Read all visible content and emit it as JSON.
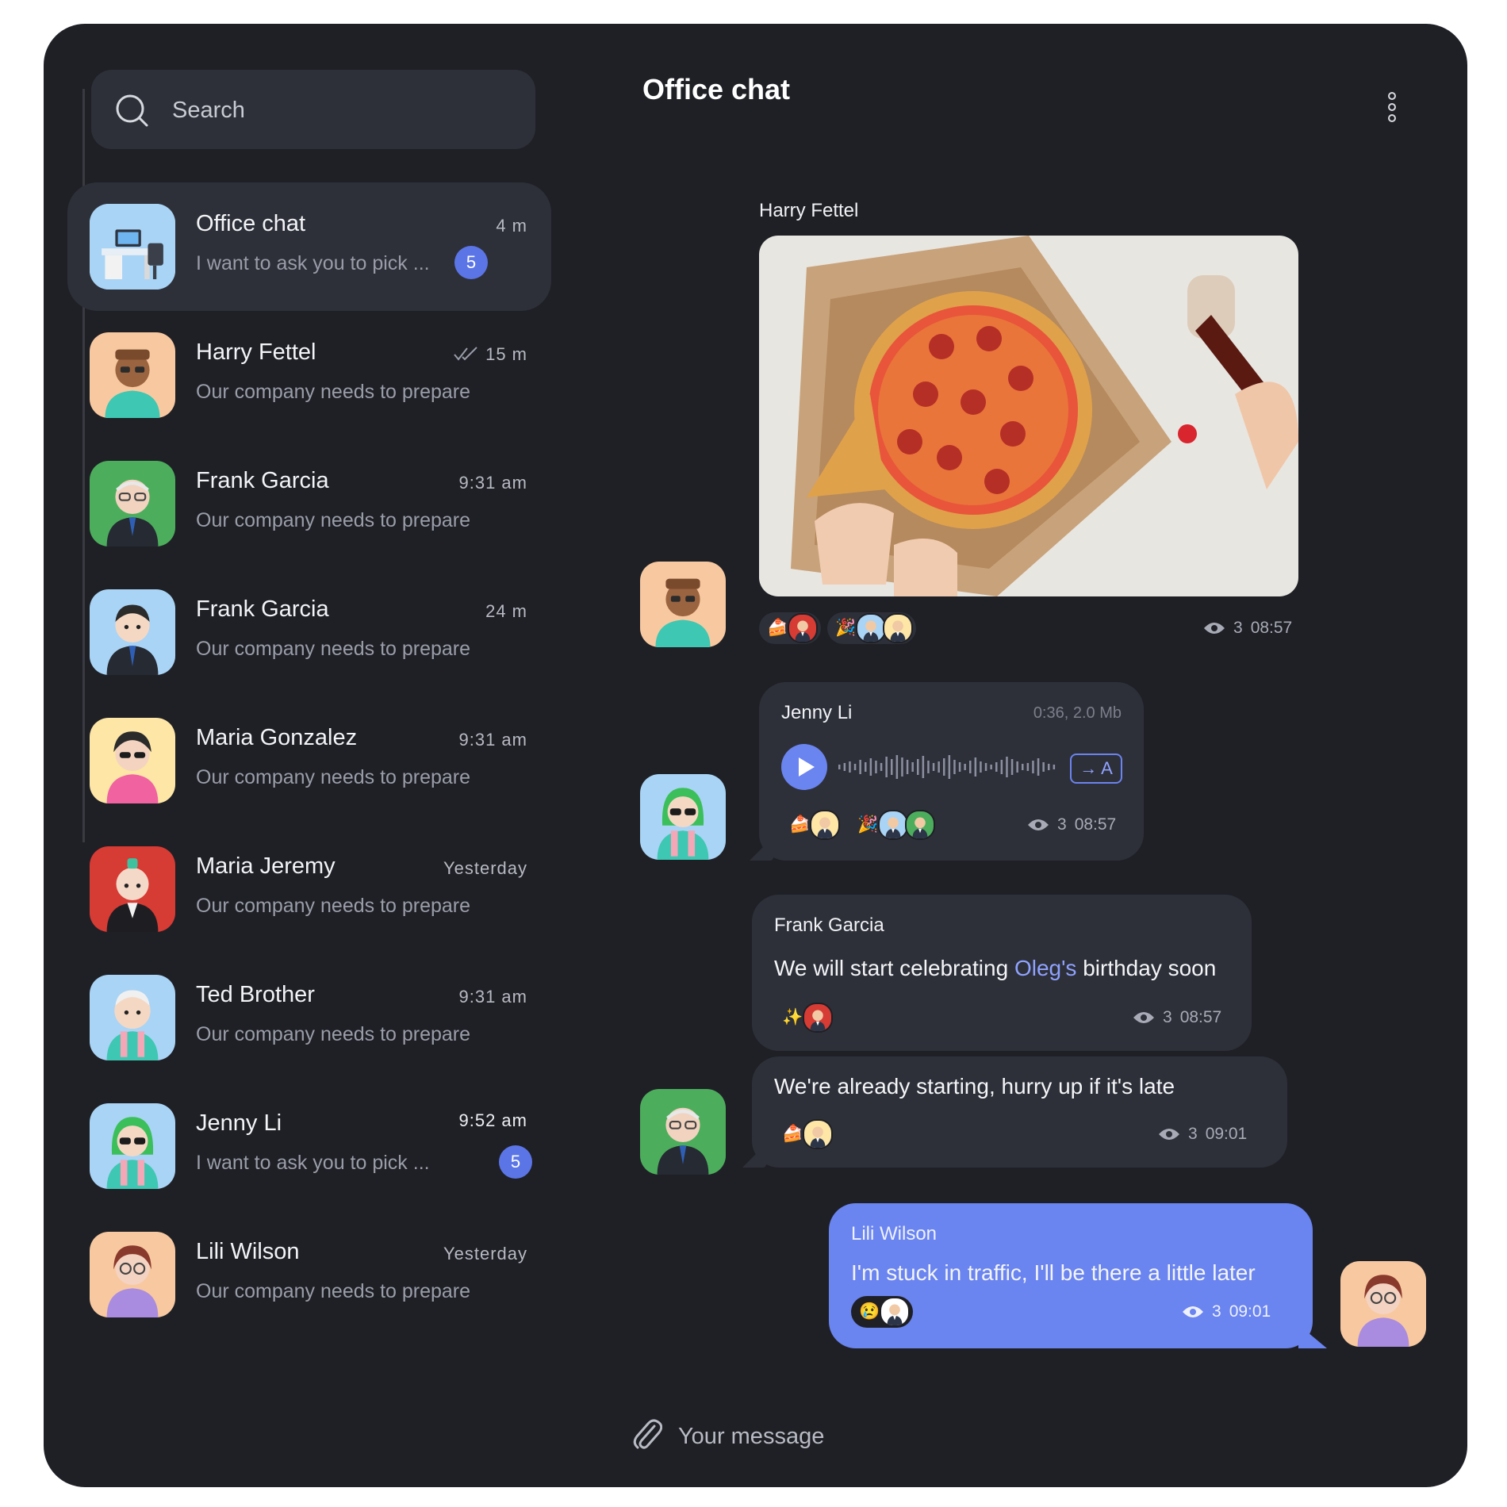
{
  "search": {
    "placeholder": "Search",
    "icon": "search-icon"
  },
  "sidebar": {
    "chats": [
      {
        "name": "Office chat",
        "preview": "I want to ask you to pick ...",
        "time": "4 m",
        "unread": "5",
        "avatar": "desk-avatar"
      },
      {
        "name": "Harry Fettel",
        "preview": "Our company needs to prepare",
        "time": "15 m",
        "read_receipt": "double-check-icon",
        "avatar": "harry-avatar"
      },
      {
        "name": "Frank Garcia",
        "preview": "Our company needs to prepare",
        "time": "9:31 am",
        "avatar": "frank-green-avatar"
      },
      {
        "name": "Frank Garcia",
        "preview": "Our company needs to prepare",
        "time": "24 m",
        "avatar": "frank-blue-avatar"
      },
      {
        "name": "Maria Gonzalez",
        "preview": "Our company needs to prepare",
        "time": "9:31 am",
        "avatar": "maria-gonzalez-avatar"
      },
      {
        "name": "Maria Jeremy",
        "preview": "Our company needs to prepare",
        "time": "Yesterday",
        "avatar": "maria-jeremy-avatar"
      },
      {
        "name": "Ted Brother",
        "preview": "Our company needs to prepare",
        "time": "9:31 am",
        "avatar": "ted-avatar"
      },
      {
        "name": "Jenny Li",
        "preview": "I want to ask you to pick ...",
        "time": "9:52 am",
        "unread": "5",
        "avatar": "jenny-avatar"
      },
      {
        "name": "Lili Wilson",
        "preview": "Our company needs to prepare",
        "time": "Yesterday",
        "avatar": "lili-avatar"
      }
    ]
  },
  "header": {
    "title": "Office chat",
    "menu_icon": "more-vertical-icon"
  },
  "messages": [
    {
      "sender": "Harry Fettel",
      "type": "photo",
      "photo": "pizza-photo",
      "reactions": [
        "cake",
        "party"
      ],
      "views": "3",
      "time": "08:57"
    },
    {
      "sender": "Jenny Li",
      "type": "voice",
      "voice_meta": "0:36, 2.0 Mb",
      "translate_label": "→ A",
      "reactions": [
        "cake",
        "party"
      ],
      "views": "3",
      "time": "08:57"
    },
    {
      "sender": "Frank Garcia",
      "type": "text",
      "text_before": "We will start celebrating ",
      "mention": "Oleg's",
      "text_after": " birthday soon",
      "reactions": [
        "sparkles"
      ],
      "views": "3",
      "time": "08:57"
    },
    {
      "sender": "Frank Garcia",
      "type": "text",
      "text": "We're already starting, hurry up if it's late",
      "reactions": [
        "cake"
      ],
      "views": "3",
      "time": "09:01"
    },
    {
      "sender": "Lili Wilson",
      "type": "text",
      "own": true,
      "text": "I'm stuck in traffic, I'll be there a little later",
      "reactions": [
        "crying"
      ],
      "views": "3",
      "time": "09:01"
    }
  ],
  "composer": {
    "placeholder": "Your message",
    "attach_icon": "paperclip-icon"
  },
  "colors": {
    "background": "#1f2026",
    "panel": "#2e3039",
    "accent": "#6a84f0",
    "mention": "#8fa3ff"
  }
}
